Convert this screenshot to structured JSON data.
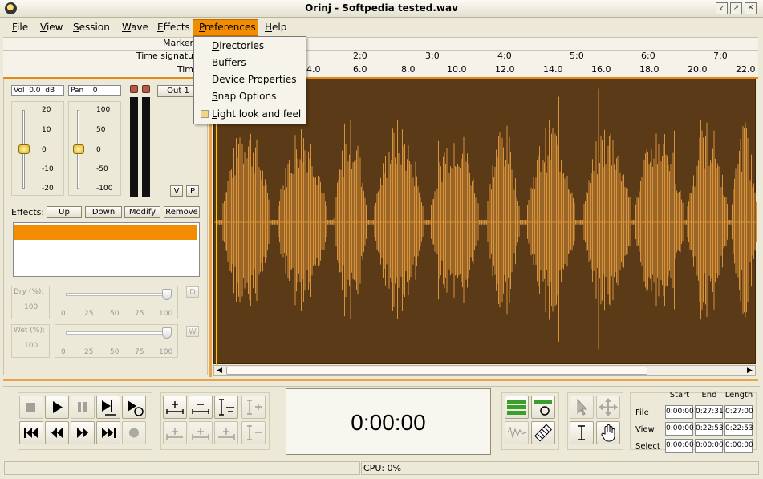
{
  "window": {
    "title": "Orinj - Softpedia tested.wav"
  },
  "menubar": {
    "items": [
      {
        "label": "File",
        "key": "F",
        "rest": "ile"
      },
      {
        "label": "View",
        "key": "V",
        "rest": "iew"
      },
      {
        "label": "Session",
        "key": "S",
        "rest": "ession"
      },
      {
        "label": "Wave",
        "key": "W",
        "rest": "ave"
      },
      {
        "label": "Effects",
        "key": "E",
        "rest": "ffects"
      },
      {
        "label": "Preferences",
        "key": "P",
        "rest": "references"
      },
      {
        "label": "Help",
        "key": "H",
        "rest": "elp"
      }
    ]
  },
  "preferences_menu": {
    "items": [
      {
        "key": "D",
        "rest": "irectories"
      },
      {
        "key": "B",
        "rest": "uffers"
      },
      {
        "key": "",
        "rest": "Device Properties"
      },
      {
        "key": "S",
        "rest": "nap Options"
      },
      {
        "key": "L",
        "rest": "ight look and feel"
      }
    ],
    "light_look_checked": false
  },
  "rulers": {
    "markers_label": "Marker",
    "time_signature_label": "Time signatu",
    "time_label": "Tim",
    "bar_ticks": [
      "2:0",
      "3:0",
      "4:0",
      "5:0",
      "6:0",
      "7:0"
    ],
    "time_ticks": [
      "4.0",
      "6.0",
      "8.0",
      "10.0",
      "12.0",
      "14.0",
      "16.0",
      "18.0",
      "20.0",
      "22.0"
    ]
  },
  "track": {
    "vol_label": "Vol",
    "vol_value": "0.0",
    "vol_unit": "dB",
    "pan_label": "Pan",
    "pan_value": "0",
    "vol_scale": [
      "20",
      "10",
      "0",
      "-10",
      "-20"
    ],
    "pan_scale": [
      "100",
      "50",
      "0",
      "-50",
      "-100"
    ],
    "out_label": "Out 1",
    "v_label": "V",
    "p_label": "P",
    "effects_label": "Effects:",
    "effect_buttons": [
      "Up",
      "Down",
      "Modify",
      "Remove"
    ],
    "dry_label": "Dry (%):",
    "dry_value": "100",
    "dry_btn": "D",
    "wet_label": "Wet (%):",
    "wet_value": "100",
    "wet_btn": "W",
    "slider_scale": [
      "0",
      "25",
      "50",
      "75",
      "100"
    ]
  },
  "transport": {
    "icons": {
      "row1": [
        "stop-icon",
        "play-icon",
        "pause-icon",
        "play-to-end-icon",
        "loop-play-icon"
      ],
      "row2": [
        "go-to-start-icon",
        "rewind-icon",
        "fast-forward-icon",
        "go-to-end-icon",
        "record-icon"
      ]
    }
  },
  "time_display": "0:00:00",
  "position": {
    "headers": [
      "Start",
      "End",
      "Length"
    ],
    "rows": [
      {
        "label": "File",
        "start": "0:00:00",
        "end": "0:27:31",
        "length": "0:27:00"
      },
      {
        "label": "View",
        "start": "0:00:00",
        "end": "0:22:53",
        "length": "0:22:53"
      },
      {
        "label": "Select",
        "start": "0:00:00",
        "end": "0:00:00",
        "length": "0:00:00"
      }
    ]
  },
  "status": {
    "cpu": "CPU: 0%"
  },
  "colors": {
    "accent": "#f28c00",
    "wave_bg": "#5b3a17",
    "wave_fg": "#d8923a",
    "chrome": "#ece9d8"
  }
}
